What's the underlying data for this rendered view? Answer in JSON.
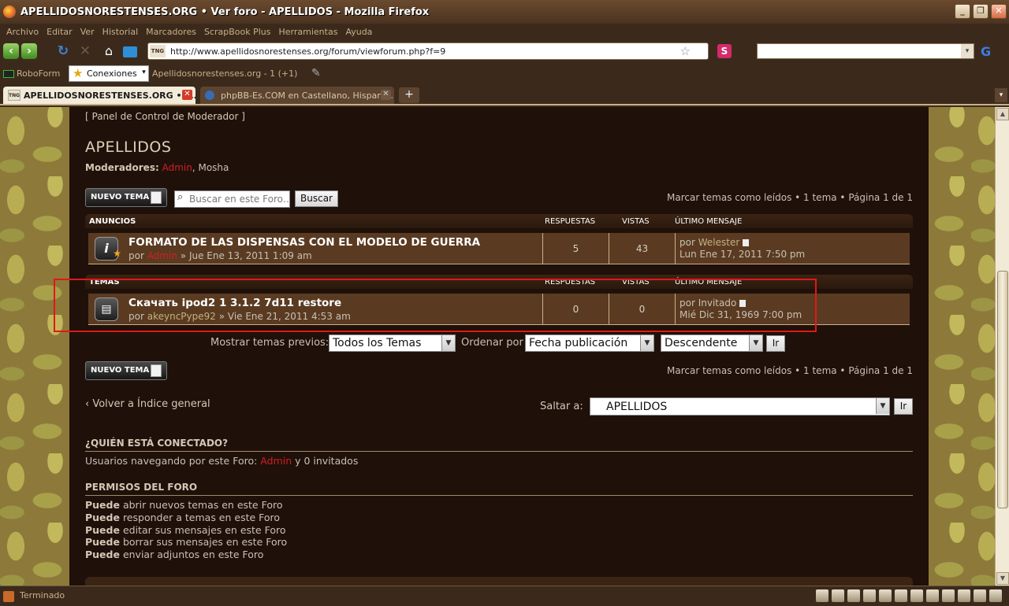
{
  "window": {
    "title": "APELLIDOSNORESTENSES.ORG • Ver foro - APELLIDOS - Mozilla Firefox"
  },
  "menu": [
    "Archivo",
    "Editar",
    "Ver",
    "Historial",
    "Marcadores",
    "ScrapBook Plus",
    "Herramientas",
    "Ayuda"
  ],
  "nav": {
    "url": "http://www.apellidosnorestenses.org/forum/viewforum.php?f=9",
    "url_favicon": "TNG"
  },
  "bookmarks": {
    "roboform": "RoboForm",
    "conexiones": "Conexiones",
    "apellidos_feed": "Apellidosnorestenses.org - 1 (+1)"
  },
  "tabs": [
    {
      "label": "APELLIDOSNORESTENSES.ORG • V...",
      "active": true
    },
    {
      "label": "phpBB-Es.COM en Castellano, Hispano ...",
      "active": false
    }
  ],
  "forum": {
    "mcp_link": "[ Panel de Control de Moderador ]",
    "title": "APELLIDOS",
    "moderators_label": "Moderadores:",
    "moderator_admin": "Admin",
    "moderator_other": ", Mosha",
    "new_topic_label": "NUEVO TEMA",
    "search_placeholder": "Buscar en este Foro…",
    "search_button": "Buscar",
    "pagination": "Marcar temas como leídos • 1 tema • Página 1 de 1",
    "columns": {
      "announcements": "ANUNCIOS",
      "topics": "TEMAS",
      "replies": "RESPUESTAS",
      "views": "VISTAS",
      "last_post": "ÚLTIMO MENSAJE"
    },
    "announcement": {
      "title": "FORMATO DE LAS DISPENSAS CON EL MODELO DE GUERRA",
      "by": "por",
      "author": "Admin",
      "date": " » Jue Ene 13, 2011 1:09 am",
      "replies": "5",
      "views": "43",
      "last_by": "por",
      "last_author": "Welester",
      "last_date": "Lun Ene 17, 2011 7:50 pm"
    },
    "topic": {
      "title": "Скачать ipod2 1 3.1.2 7d11 restore",
      "by": "por",
      "author": "akeyncPype92",
      "date": " » Vie Ene 21, 2011 4:53 am",
      "replies": "0",
      "views": "0",
      "last_by": "por Invitado",
      "last_date": "Mié Dic 31, 1969 7:00 pm"
    },
    "filters": {
      "show_label": "Mostrar temas previos:",
      "show_value": "Todos los Temas",
      "sort_label": "Ordenar por",
      "sort_value": "Fecha publicación",
      "order_value": "Descendente",
      "go": "Ir"
    },
    "back_to_index": "‹ Volver a Índice general",
    "jump_label": "Saltar a:",
    "jump_value": "APELLIDOS",
    "jump_go": "Ir",
    "online": {
      "title": "¿QUIÉN ESTÁ CONECTADO?",
      "prefix": "Usuarios navegando por este Foro: ",
      "admin": "Admin",
      "suffix": " y 0 invitados"
    },
    "permissions": {
      "title": "PERMISOS DEL FORO",
      "can": "Puede",
      "items": [
        " abrir nuevos temas en este Foro",
        " responder a temas en este Foro",
        " editar sus mensajes en este Foro",
        " borrar sus mensajes en este Foro",
        " enviar adjuntos en este Foro"
      ]
    }
  },
  "status": {
    "text": "Terminado"
  }
}
